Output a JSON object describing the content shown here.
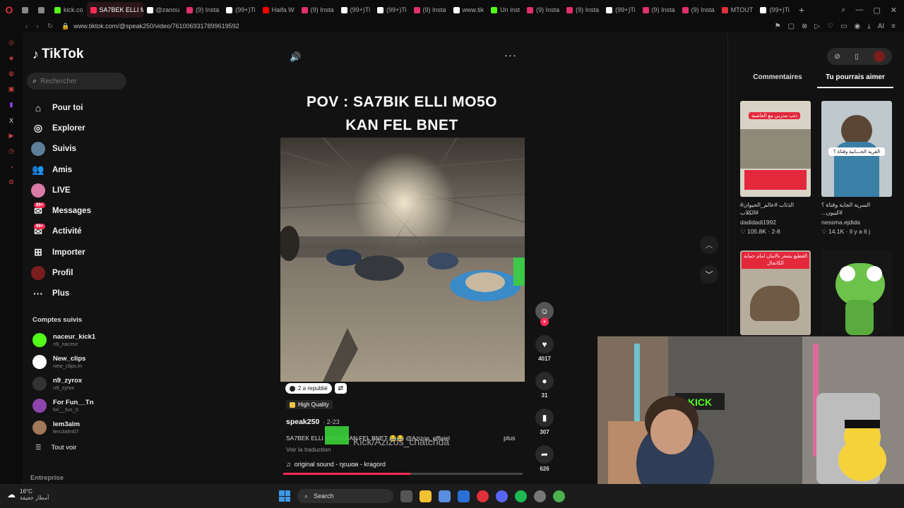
{
  "browser": {
    "tabs": [
      {
        "label": "",
        "color": "#888888"
      },
      {
        "label": "",
        "color": "#888888"
      },
      {
        "label": "kick.co",
        "color": "#53fc18"
      },
      {
        "label": "SA7BEK ELLI M",
        "color": "#fe2c55",
        "active": true
      },
      {
        "label": "@zanou",
        "color": "#ffffff"
      },
      {
        "label": "(9) Insta",
        "color": "#e1306c"
      },
      {
        "label": "(99+)Ti",
        "color": "#ffffff"
      },
      {
        "label": "Haifa W",
        "color": "#ff0000"
      },
      {
        "label": "(9) Insta",
        "color": "#e1306c"
      },
      {
        "label": "(99+)Ti",
        "color": "#ffffff"
      },
      {
        "label": "(99+)Ti",
        "color": "#ffffff"
      },
      {
        "label": "(9) Insta",
        "color": "#e1306c"
      },
      {
        "label": "www.tik",
        "color": "#ffffff"
      },
      {
        "label": "Un inst",
        "color": "#53fc18"
      },
      {
        "label": "(9) Insta",
        "color": "#e1306c"
      },
      {
        "label": "(9) Insta",
        "color": "#e1306c"
      },
      {
        "label": "(99+)Ti",
        "color": "#ffffff"
      },
      {
        "label": "(9) Insta",
        "color": "#e1306c"
      },
      {
        "label": "(9) Insta",
        "color": "#e1306c"
      },
      {
        "label": "MTOUT",
        "color": "#e0303b"
      },
      {
        "label": "(99+)Ti",
        "color": "#ffffff"
      }
    ],
    "url": "www.tiktok.com/@speak250/video/7610069317899619592"
  },
  "tiktok": {
    "logo": "TikTok",
    "search_placeholder": "Rechercher",
    "nav": [
      {
        "label": "Pour toi",
        "icon": "home-icon"
      },
      {
        "label": "Explorer",
        "icon": "compass-icon"
      },
      {
        "label": "Suivis",
        "icon": "avatar"
      },
      {
        "label": "Amis",
        "icon": "friends-icon"
      },
      {
        "label": "LIVE",
        "icon": "avatar"
      },
      {
        "label": "Messages",
        "icon": "messages-icon",
        "badge": "99+"
      },
      {
        "label": "Activité",
        "icon": "activity-icon",
        "badge": "99+"
      },
      {
        "label": "Importer",
        "icon": "upload-icon"
      },
      {
        "label": "Profil",
        "icon": "avatar"
      },
      {
        "label": "Plus",
        "icon": "more-icon"
      }
    ],
    "following_title": "Comptes suivis",
    "following": [
      {
        "name": "naceur_kick1",
        "handle": "n9_naceur",
        "color": "#53fc18"
      },
      {
        "name": "New_clips",
        "handle": "new_clips.tn",
        "color": "#ffffff"
      },
      {
        "name": "n9_zyrox",
        "handle": "n9_zyrox",
        "color": "#333333"
      },
      {
        "name": "For Fun__Tn",
        "handle": "for__fun_0",
        "color": "#8e44ad"
      },
      {
        "name": "lem3alm",
        "handle": "lem3alm07",
        "color": "#a0785a"
      }
    ],
    "see_all": "Tout voir",
    "enterprise": "Entreprise"
  },
  "video": {
    "title_line1": "POV : SA7BIK ELLI MO5O",
    "title_line2": "KAN FEL BNET",
    "republished": "2 a republié",
    "quality": "High Quality",
    "author": "speak250",
    "date": "· 2-23",
    "description": "SA7BEK ELLI MOSO KAN FEL BNET 😂😂 @Azizos_officiel",
    "more": "plus",
    "translate": "Voir la traduction",
    "music": "original sound - ɳɛɯɑɵ - kragord",
    "likes": "4017",
    "comments": "31",
    "saves": "307",
    "shares": "626",
    "progress": 0.53,
    "overlay_text": "Kick/Azizos_chatchda"
  },
  "right_panel": {
    "tab_comments": "Commentaires",
    "tab_suggest": "Tu pourrais aimer",
    "cards": [
      {
        "banner": "ذئب مدربي مع العاشية",
        "caption": "الذئاب #عالم_الحيوان# #الكلاب",
        "user": "dadidadi1992",
        "stats": "♡ 105.8K · 2-8"
      },
      {
        "banner": "القرية الجـــانية وقتاة ؟",
        "caption": "السرية الجاية وقتاة ؟ #كيبون...",
        "user": "nessma.ejdida",
        "stats": "♡ 14.1K · Il y a 6 j"
      },
      {
        "banner": "القطيع يشعر بالامان امام حماية الكانجال",
        "caption": "",
        "user": "",
        "stats": ""
      },
      {
        "banner": "",
        "caption": "",
        "user": "",
        "stats": ""
      }
    ]
  },
  "taskbar": {
    "temp": "16°C",
    "weather": "أمطار خفيفة",
    "search": "Search"
  }
}
